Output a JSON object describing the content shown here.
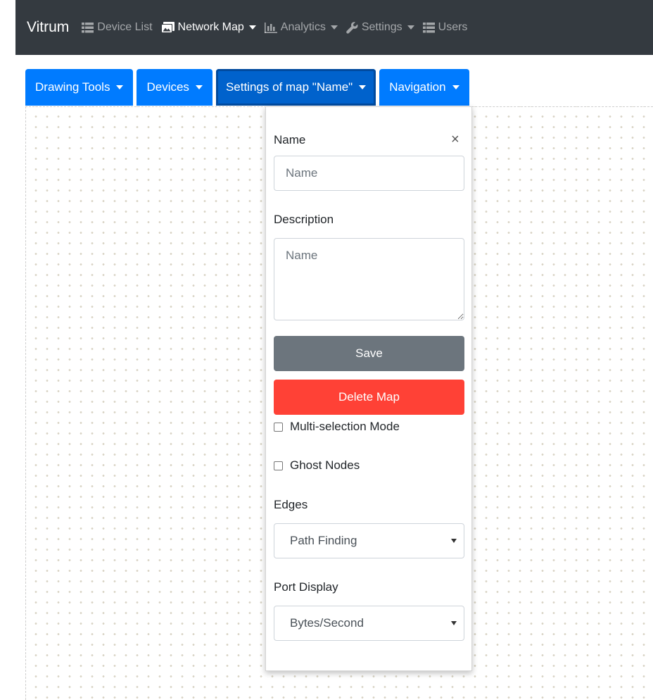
{
  "navbar": {
    "brand": "Vitrum",
    "items": [
      {
        "label": "Device List",
        "icon": "list-icon",
        "dropdown": false,
        "active": false
      },
      {
        "label": "Network Map",
        "icon": "image-icon",
        "dropdown": true,
        "active": true
      },
      {
        "label": "Analytics",
        "icon": "bar-chart-icon",
        "dropdown": true,
        "active": false
      },
      {
        "label": "Settings",
        "icon": "wrench-icon",
        "dropdown": true,
        "active": false
      },
      {
        "label": "Users",
        "icon": "list-icon",
        "dropdown": false,
        "active": false
      }
    ]
  },
  "toolbar": {
    "buttons": [
      {
        "label": "Drawing Tools"
      },
      {
        "label": "Devices"
      },
      {
        "label": "Settings of map \"Name\"",
        "active": true
      },
      {
        "label": "Navigation"
      }
    ]
  },
  "panel": {
    "name_label": "Name",
    "close_glyph": "×",
    "name_placeholder": "Name",
    "description_label": "Description",
    "description_placeholder": "Name",
    "save_label": "Save",
    "delete_label": "Delete Map",
    "multi_selection_label": "Multi-selection Mode",
    "multi_selection_checked": false,
    "ghost_nodes_label": "Ghost Nodes",
    "ghost_nodes_checked": false,
    "edges_label": "Edges",
    "edges_value": "Path Finding",
    "port_display_label": "Port Display",
    "port_display_value": "Bytes/Second"
  },
  "colors": {
    "navbar_bg": "#343a40",
    "primary": "#007bff",
    "save": "#6c757d",
    "delete": "#ff4136"
  }
}
